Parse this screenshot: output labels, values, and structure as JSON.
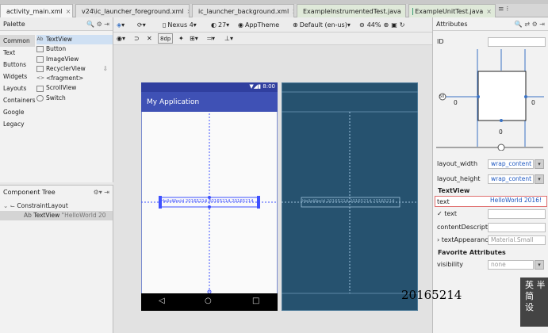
{
  "tabs": [
    {
      "label": "activity_main.xml",
      "active": true
    },
    {
      "label": "v24\\ic_launcher_foreground.xml",
      "active": false
    },
    {
      "label": "ic_launcher_background.xml",
      "active": false
    },
    {
      "label": "ExampleInstrumentedTest.java",
      "active": false
    },
    {
      "label": "ExampleUnitTest.java",
      "active": false
    }
  ],
  "tab_close": "×",
  "palette": {
    "title": "Palette",
    "categories": [
      "Common",
      "Text",
      "Buttons",
      "Widgets",
      "Layouts",
      "Containers",
      "Google",
      "Legacy"
    ],
    "items": [
      "TextView",
      "Button",
      "ImageView",
      "RecyclerView",
      "<fragment>",
      "ScrollView",
      "Switch"
    ],
    "item_icons": [
      "Ab",
      "",
      "",
      "",
      "<>",
      "",
      ""
    ]
  },
  "component_tree": {
    "title": "Component Tree",
    "root": "ConstraintLayout",
    "child_icon": "Ab",
    "child": "TextView",
    "child_value": "\"HelloWorld 20"
  },
  "toolbar": {
    "device": "Nexus 4",
    "api": "27",
    "theme": "AppTheme",
    "locale": "Default (en-us)",
    "zoom": "44%",
    "dp_label": "8dp"
  },
  "phone": {
    "app_title": "My Application",
    "time": "8:00",
    "textview_text": "HelloWorld 20165214 20165214 20165214",
    "blueprint_text": "HelloWorld 20165214 20165214 20165214",
    "nav_back": "◁",
    "nav_home": "○",
    "nav_recent": "□"
  },
  "attributes": {
    "title": "Attributes",
    "id_label": "ID",
    "margin_left": "0",
    "margin_right": "0",
    "margin_bottom": "0",
    "bias_value": "50",
    "layout_width_label": "layout_width",
    "layout_width_value": "wrap_content",
    "layout_height_label": "layout_height",
    "layout_height_value": "wrap_content",
    "textview_section": "TextView",
    "text_label": "text",
    "text_value": "HelloWorld 2016!",
    "text_tool_label": "✓ text",
    "content_desc_label": "contentDescripti",
    "text_appearance_label": "› textAppearanc",
    "text_appearance_value": "Material.Small",
    "favorites_section": "Favorite Attributes",
    "visibility_label": "visibility",
    "visibility_value": "none"
  },
  "overlay_caption": "20165214",
  "watermark": "英 半\n简\n设"
}
